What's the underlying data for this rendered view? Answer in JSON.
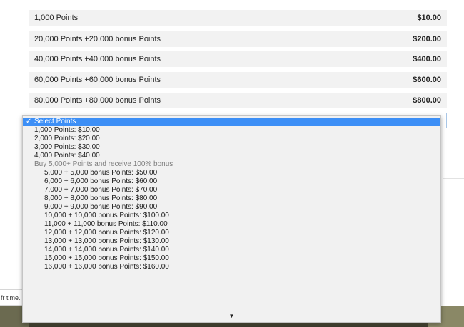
{
  "price_rows": [
    {
      "label": "1,000 Points",
      "amount": "$10.00"
    },
    {
      "label": "20,000 Points +20,000 bonus Points",
      "amount": "$200.00"
    },
    {
      "label": "40,000 Points +40,000 bonus Points",
      "amount": "$400.00"
    },
    {
      "label": "60,000 Points +60,000 bonus Points",
      "amount": "$600.00"
    },
    {
      "label": "80,000 Points +80,000 bonus Points",
      "amount": "$800.00"
    }
  ],
  "menu": {
    "selected_label": "Select Points",
    "check_glyph": "✓",
    "options": [
      "1,000 Points: $10.00",
      "2,000 Points: $20.00",
      "3,000 Points: $30.00",
      "4,000 Points: $40.00"
    ],
    "group_label": "Buy 5,000+ Points and receive 100% bonus",
    "group_options": [
      "5,000 + 5,000 bonus Points: $50.00",
      "6,000 + 6,000 bonus Points: $60.00",
      "7,000 + 7,000 bonus Points: $70.00",
      "8,000 + 8,000 bonus Points: $80.00",
      "9,000 + 9,000 bonus Points: $90.00",
      "10,000 + 10,000 bonus Points: $100.00",
      "11,000 + 11,000 bonus Points: $110.00",
      "12,000 + 12,000 bonus Points: $120.00",
      "13,000 + 13,000 bonus Points: $130.00",
      "14,000 + 14,000 bonus Points: $140.00",
      "15,000 + 15,000 bonus Points: $150.00",
      "16,000 + 16,000 bonus Points: $160.00"
    ],
    "scroll_down_glyph": "▼"
  },
  "background": {
    "left_snippet": "fr time."
  },
  "colors": {
    "selection": "#3d8ff6",
    "menu_bg": "#f1f1f1",
    "row_bg": "#f2f2f2"
  }
}
